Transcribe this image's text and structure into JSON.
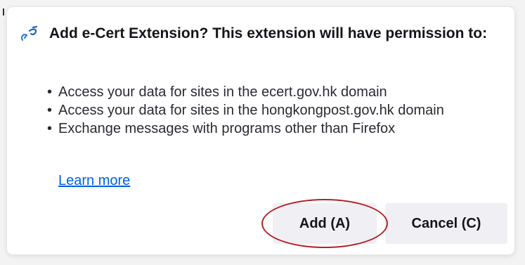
{
  "dialog": {
    "title": "Add e-Cert Extension? This extension will have permission to:",
    "icon": "extension-link-icon",
    "permissions": [
      "Access your data for sites in the ecert.gov.hk domain",
      "Access your data for sites in the hongkongpost.gov.hk domain",
      "Exchange messages with programs other than Firefox"
    ],
    "learn_more": "Learn more",
    "add_button": "Add (A)",
    "cancel_button": "Cancel (C)"
  },
  "colors": {
    "link": "#0061e0",
    "button_bg": "#f0f0f4",
    "annotation_ring": "#b41e27"
  }
}
